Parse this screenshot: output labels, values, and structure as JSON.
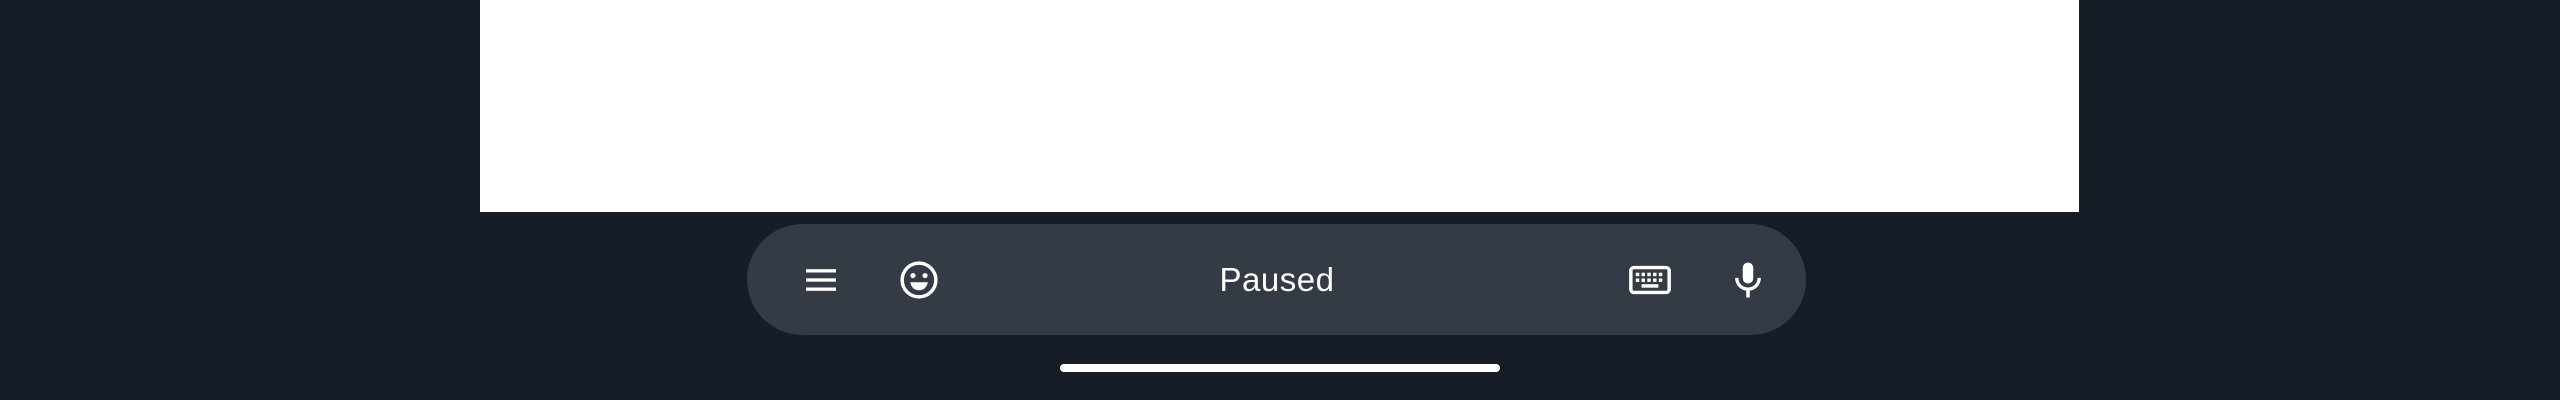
{
  "app": {
    "screen": "remote-session-view"
  },
  "toolbar": {
    "status_label": "Paused",
    "buttons": [
      {
        "id": "menu",
        "icon": "hamburger-menu-icon"
      },
      {
        "id": "emoji",
        "icon": "smiley-face-icon"
      },
      {
        "id": "keyboard",
        "icon": "keyboard-icon"
      },
      {
        "id": "mic",
        "icon": "microphone-icon"
      }
    ]
  },
  "colors": {
    "background": "#161d26",
    "toolbar": "#353b44",
    "content": "#ffffff",
    "icon": "#ffffff"
  }
}
